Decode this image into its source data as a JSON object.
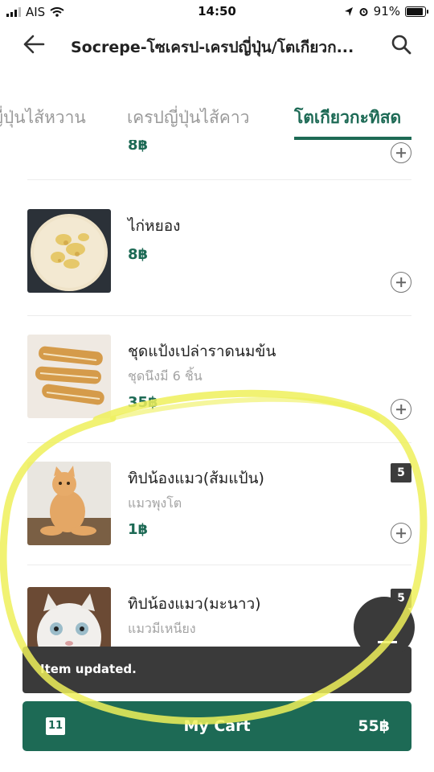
{
  "status_bar": {
    "carrier": "AIS",
    "time": "14:50",
    "battery": "91%"
  },
  "header": {
    "title": "Socrepe-โซเครป-เครปญี่ปุ่น/โตเกียวก...",
    "back_icon": "arrow-left-icon",
    "search_icon": "search-icon"
  },
  "tabs": [
    {
      "label": "ญี่ปุ่นไส้หวาน",
      "active": false
    },
    {
      "label": "เครปญี่ปุ่นไส้คาว",
      "active": false
    },
    {
      "label": "โตเกียวกะทิสด",
      "active": true
    }
  ],
  "items": [
    {
      "name": "",
      "desc": "",
      "price": "8฿"
    },
    {
      "name": "ไก่หยอง",
      "desc": "",
      "price": "8฿"
    },
    {
      "name": "ชุดแป้งเปล่าราดนมข้น",
      "desc": "ชุดนึงมี 6 ชิ้น",
      "price": "35฿"
    },
    {
      "name": "ทิปน้องแมว(ส้มแป้น)",
      "desc": "แมวพุงโต",
      "price": "1฿",
      "qty": "5"
    },
    {
      "name": "ทิปน้องแมว(มะนาว)",
      "desc": "แมวมีเหนียง",
      "price": "",
      "qty": "5"
    }
  ],
  "toast": {
    "text": "Item updated."
  },
  "cart": {
    "count": "11",
    "label": "My Cart",
    "total": "55฿"
  },
  "colors": {
    "accent": "#1d6a55",
    "toast": "#3a3a3a",
    "annotation": "#eef05a"
  }
}
